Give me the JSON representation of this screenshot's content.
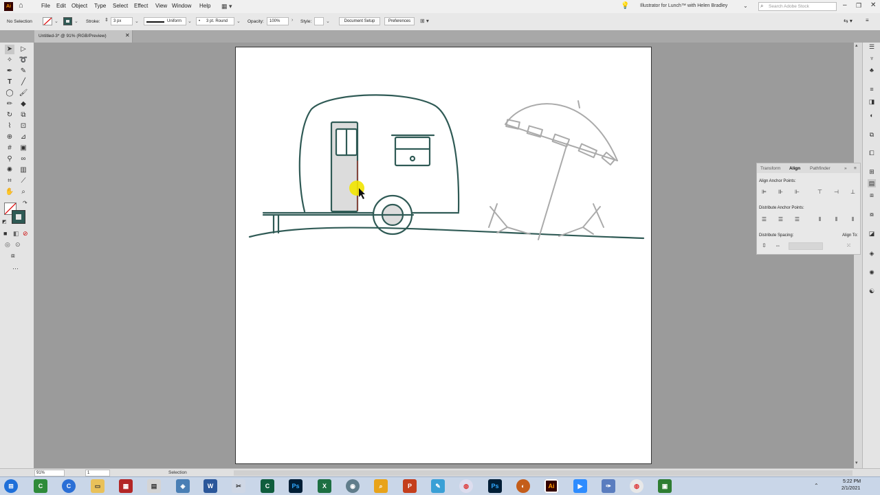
{
  "menu": {
    "items": [
      "File",
      "Edit",
      "Object",
      "Type",
      "Select",
      "Effect",
      "View",
      "Window",
      "Help"
    ],
    "workspace_title": "Illustrator for Lunch™ with Helen Bradley",
    "search_placeholder": "Search Adobe Stock"
  },
  "control": {
    "selection_label": "No Selection",
    "stroke_label": "Stroke:",
    "stroke_weight": "3 px",
    "profile": "Uniform",
    "brush": "3 pt. Round",
    "opacity_label": "Opacity:",
    "opacity": "100%",
    "style_label": "Style:",
    "document_setup": "Document Setup",
    "preferences": "Preferences"
  },
  "document": {
    "tab_title": "Untitled-3* @ 91% (RGB/Preview)"
  },
  "align_panel": {
    "tabs": [
      "Transform",
      "Align",
      "Pathfinder"
    ],
    "align_anchor_points": "Align Anchor Points:",
    "distribute_anchor_points": "Distribute Anchor Points:",
    "distribute_spacing": "Distribute Spacing:",
    "align_to": "Align To:"
  },
  "status": {
    "zoom": "91%",
    "artboard": "1",
    "tool": "Selection"
  },
  "taskbar": {
    "time": "5:22 PM",
    "date": "2/1/2021"
  },
  "colors": {
    "stroke_teal": "#2f5a55",
    "ai_orange": "#ff9a00",
    "cursor_highlight": "#f2e600"
  }
}
